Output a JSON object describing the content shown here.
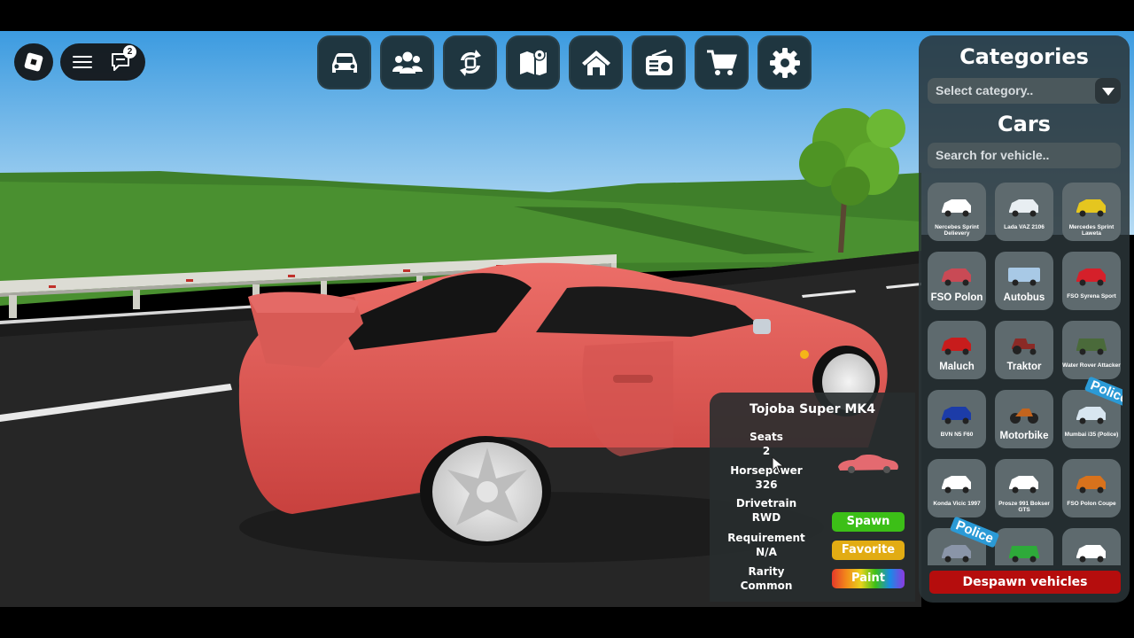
{
  "roblox": {
    "chat_badge": "2"
  },
  "toolbar": {
    "buttons": [
      {
        "icon": "car-icon"
      },
      {
        "icon": "players-icon"
      },
      {
        "icon": "swap-icon"
      },
      {
        "icon": "map-icon"
      },
      {
        "icon": "home-icon"
      },
      {
        "icon": "radio-icon"
      },
      {
        "icon": "cart-icon"
      },
      {
        "icon": "settings-gear-icon"
      }
    ]
  },
  "panel": {
    "categories_title": "Categories",
    "select_placeholder": "Select category..",
    "cars_title": "Cars",
    "search_placeholder": "Search for vehicle..",
    "vehicles": [
      {
        "label": "Nercebes Sprint Delievery",
        "size": "small",
        "color": "#ffffff"
      },
      {
        "label": "Lada VAZ 2106",
        "size": "small",
        "color": "#e8eef2"
      },
      {
        "label": "Mercedes Sprint Laweta",
        "size": "small",
        "color": "#e5c61f"
      },
      {
        "label": "FSO Polon",
        "size": "big",
        "color": "#c94a55"
      },
      {
        "label": "Autobus",
        "size": "big",
        "color": "#a8c9e6"
      },
      {
        "label": "FSO Syrena Sport",
        "size": "small",
        "color": "#d5202a"
      },
      {
        "label": "Maluch",
        "size": "big",
        "color": "#c81c1c"
      },
      {
        "label": "Traktor",
        "size": "big",
        "color": "#8b2a26"
      },
      {
        "label": "Water Rover Attacker",
        "size": "small",
        "color": "#4a6a3a"
      },
      {
        "label": "BVN N5 F60",
        "size": "small",
        "color": "#1c3ca8"
      },
      {
        "label": "Motorbike",
        "size": "big",
        "color": "#c2641e"
      },
      {
        "label": "Mumbai i35 (Police)",
        "size": "small",
        "color": "#d8e6f0",
        "tag": "Police"
      },
      {
        "label": "Konda Vicic 1997",
        "size": "small",
        "color": "#ffffff"
      },
      {
        "label": "Prosze 991 Bokser GTS",
        "size": "small",
        "color": "#ffffff"
      },
      {
        "label": "FSO Polon Coupe",
        "size": "small",
        "color": "#d8721c"
      },
      {
        "label": "",
        "size": "small",
        "color": "#8a95a8",
        "tag": "Police"
      },
      {
        "label": "",
        "size": "small",
        "color": "#2eaa3a"
      },
      {
        "label": "",
        "size": "small",
        "color": "#ffffff"
      }
    ],
    "despawn_label": "Despawn vehicles"
  },
  "info": {
    "title": "Tojoba Super MK4",
    "seats_label": "Seats",
    "seats_value": "2",
    "horsepower_label": "Horsepower",
    "horsepower_value": "326",
    "drivetrain_label": "Drivetrain",
    "drivetrain_value": "RWD",
    "requirement_label": "Requirement",
    "requirement_value": "N/A",
    "rarity_label": "Rarity",
    "rarity_value": "Common",
    "preview_color": "#e46a70",
    "spawn_label": "Spawn",
    "favorite_label": "Favorite",
    "paint_label": "Paint"
  },
  "colors": {
    "toolbar_bg": "#1f3640",
    "spawn": "#3cbf17",
    "favorite": "#e2ac13",
    "despawn": "#b50d0d",
    "car_body": "#e25a56"
  }
}
